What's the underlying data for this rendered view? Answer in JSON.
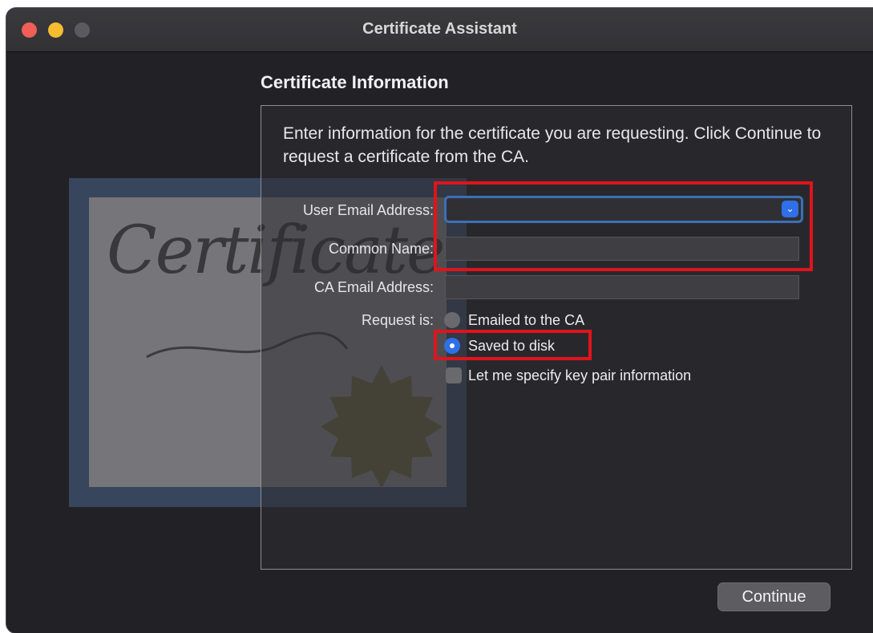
{
  "window": {
    "title": "Certificate Assistant"
  },
  "decoration": {
    "script_text": "Certificate"
  },
  "section": {
    "heading": "Certificate Information"
  },
  "intro": {
    "text": "Enter information for the certificate you are requesting. Click Continue to request a certificate from the CA."
  },
  "form": {
    "user_email_label": "User Email Address:",
    "user_email_value": "",
    "common_name_label": "Common Name:",
    "common_name_value": "",
    "ca_email_label": "CA Email Address:",
    "ca_email_value": "",
    "request_label": "Request is:",
    "request_options": [
      {
        "label": "Emailed to the CA",
        "selected": false
      },
      {
        "label": "Saved to disk",
        "selected": true
      }
    ],
    "key_pair_label": "Let me specify key pair information",
    "key_pair_checked": false
  },
  "buttons": {
    "continue_label": "Continue"
  },
  "colors": {
    "accent": "#2f6fe8",
    "highlight": "#e0141c",
    "background": "#222226"
  }
}
